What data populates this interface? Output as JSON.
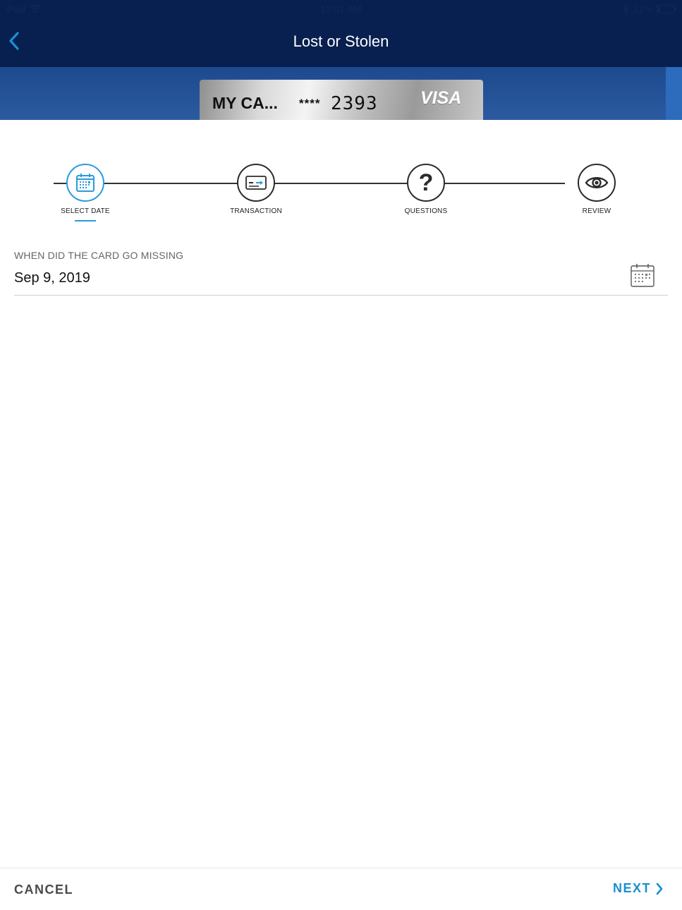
{
  "status_bar": {
    "device": "iPad",
    "time": "10:01 AM",
    "battery": "11%"
  },
  "header": {
    "title": "Lost or Stolen",
    "back_icon": "chevron-left-icon"
  },
  "card": {
    "name": "MY CA...",
    "masked": "****",
    "last4": "2393",
    "brand": "VISA"
  },
  "stepper": {
    "active_index": 0,
    "steps": [
      {
        "label": "SELECT DATE",
        "icon": "calendar-icon"
      },
      {
        "label": "TRANSACTION",
        "icon": "card-transaction-icon"
      },
      {
        "label": "QUESTIONS",
        "icon": "question-mark-icon"
      },
      {
        "label": "REVIEW",
        "icon": "eye-icon"
      }
    ]
  },
  "date_field": {
    "label": "WHEN DID THE CARD GO MISSING",
    "value": "Sep 9, 2019",
    "icon": "calendar-icon"
  },
  "footer": {
    "cancel_label": "CANCEL",
    "next_label": "NEXT"
  },
  "colors": {
    "header_bg": "#07204f",
    "band_bg": "#2c5aa0",
    "accent": "#2a9bdc",
    "next": "#1a8fd1"
  }
}
